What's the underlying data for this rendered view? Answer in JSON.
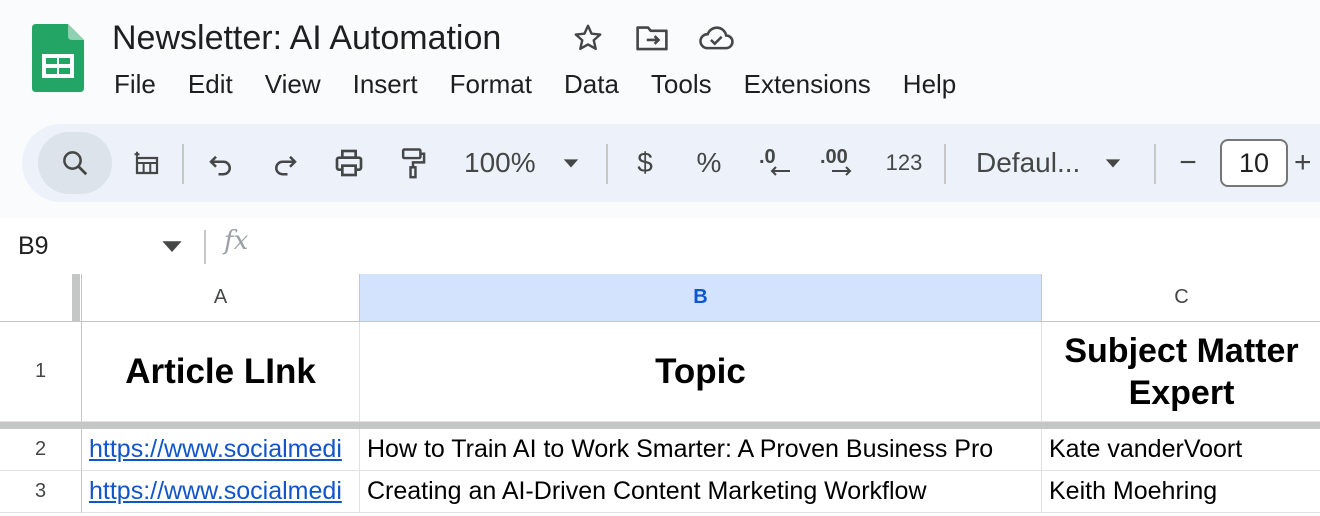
{
  "app": {
    "doc_title": "Newsletter: AI Automation",
    "colors": {
      "sheets_green": "#23a566",
      "toolbar_bg": "#edf2fa",
      "selected_header": "#d3e3fd",
      "link": "#1155cc"
    }
  },
  "header": {
    "icons": [
      "star-icon",
      "move-to-folder-icon",
      "cloud-saved-icon"
    ]
  },
  "menu": [
    "File",
    "Edit",
    "View",
    "Insert",
    "Format",
    "Data",
    "Tools",
    "Extensions",
    "Help"
  ],
  "toolbar": {
    "zoom": "100%",
    "currency_label": "$",
    "percent_label": "%",
    "decrease_decimal_label": ".0",
    "increase_decimal_label": ".00",
    "more_formats_label": "123",
    "font_family": "Defaul...",
    "font_size": "10",
    "minus_label": "−",
    "plus_label": "+"
  },
  "formula_bar": {
    "name_box": "B9",
    "fx_label": "fx"
  },
  "grid": {
    "columns": [
      "A",
      "B",
      "C"
    ],
    "rows": [
      {
        "num": "1",
        "cells": [
          "Article LInk",
          "Topic",
          "Subject Matter Expert"
        ]
      },
      {
        "num": "2",
        "cells": [
          "https://www.socialmedi",
          "How to Train AI to Work Smarter: A Proven Business Pro",
          "Kate vanderVoort"
        ]
      },
      {
        "num": "3",
        "cells": [
          "https://www.socialmedi",
          "Creating an AI-Driven Content Marketing Workflow",
          "Keith Moehring"
        ]
      }
    ]
  }
}
